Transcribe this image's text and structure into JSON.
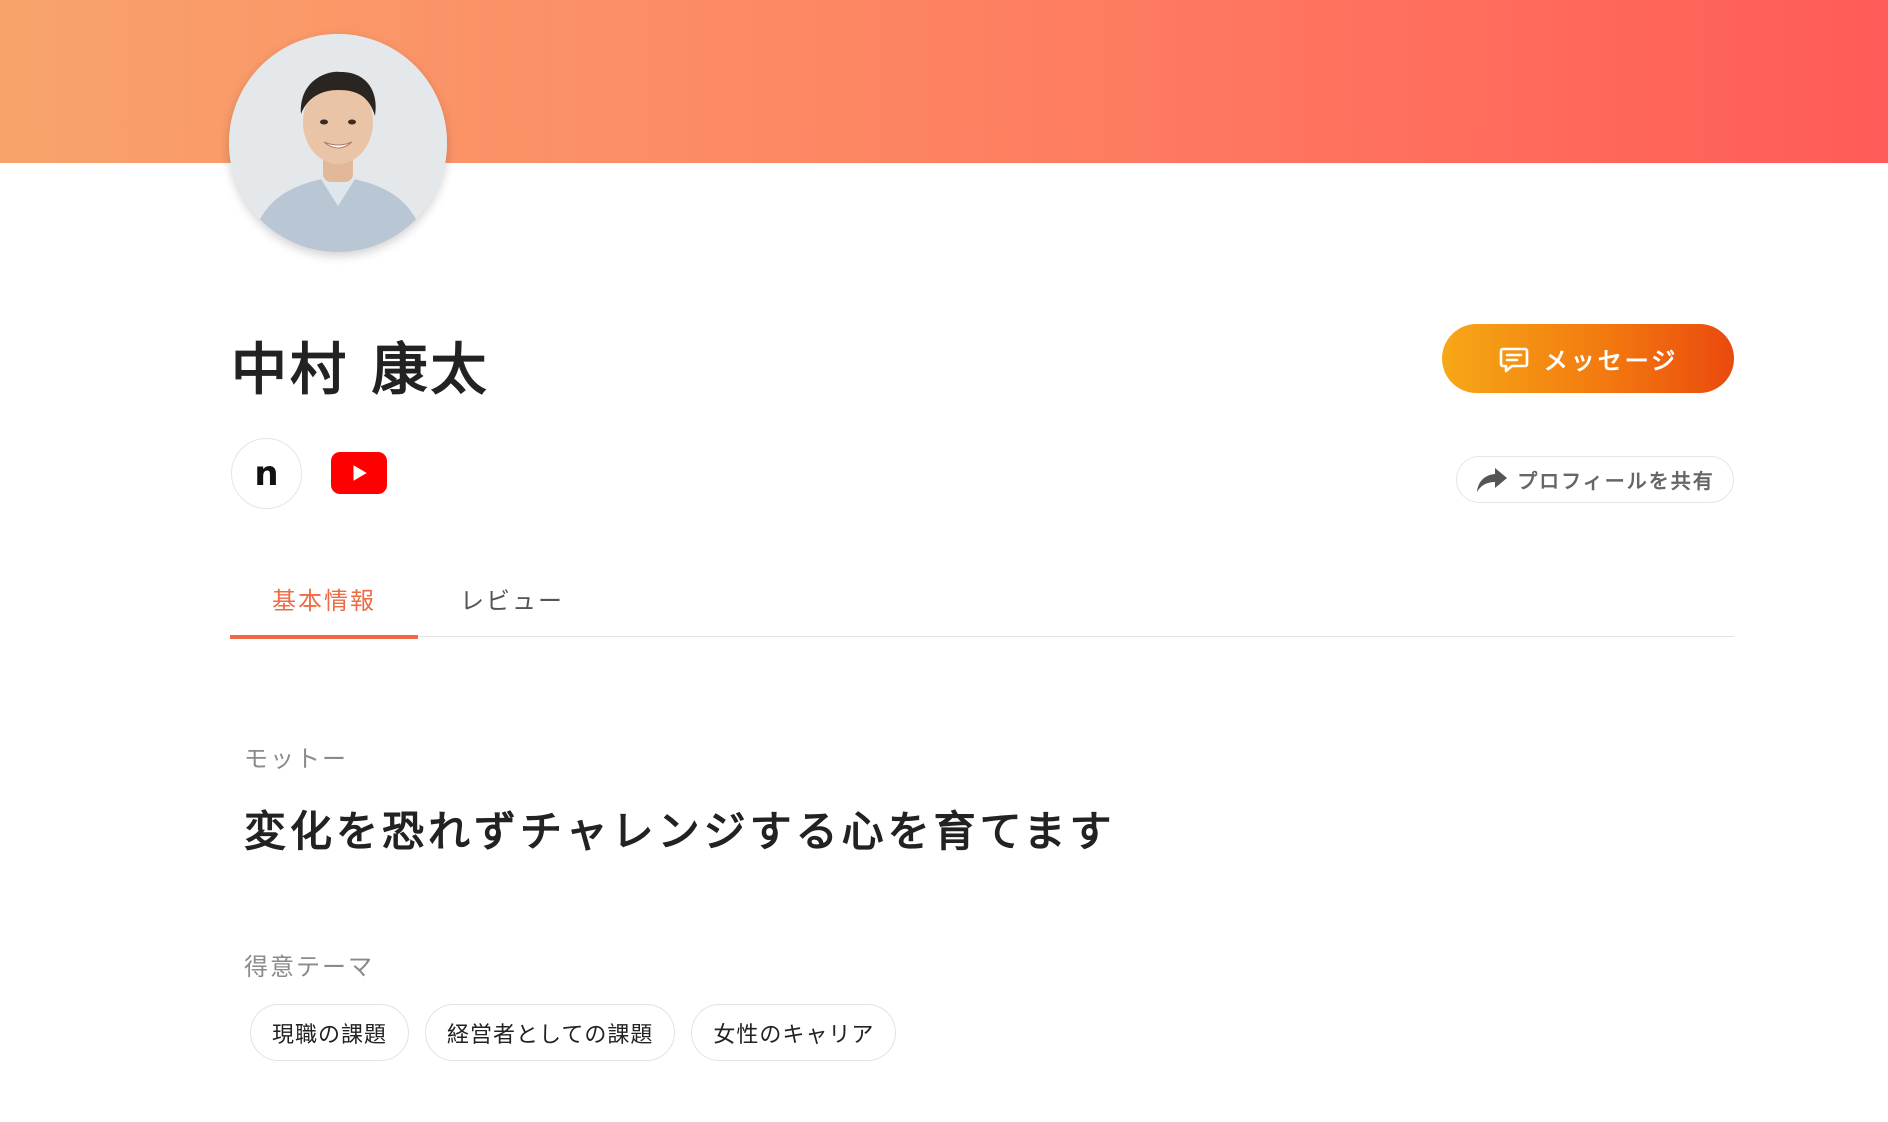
{
  "profile": {
    "name": "中村 康太"
  },
  "actions": {
    "message_label": "メッセージ",
    "share_label": "プロフィールを共有"
  },
  "social": {
    "note_glyph": "n",
    "items": [
      "note-icon",
      "youtube-icon"
    ]
  },
  "tabs": [
    {
      "label": "基本情報",
      "active": true
    },
    {
      "label": "レビュー",
      "active": false
    }
  ],
  "motto": {
    "label": "モットー",
    "text": "変化を恐れずチャレンジする心を育てます"
  },
  "themes": {
    "label": "得意テーマ",
    "items": [
      "現職の課題",
      "経営者としての課題",
      "女性のキャリア"
    ]
  },
  "colors": {
    "banner_start": "#f8a36c",
    "banner_end": "#ff5b58",
    "accent": "#ee6b45",
    "message_button_start": "#f6a817",
    "message_button_end": "#ea4a0e",
    "youtube_red": "#ff0000"
  }
}
